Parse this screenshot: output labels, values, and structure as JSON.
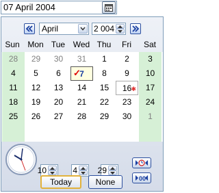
{
  "date_field": {
    "value": "07 April 2004"
  },
  "icons": {
    "calendar_dropdown": "calendar-icon",
    "prev_month": "double-chevron-left-icon",
    "next_month": "double-chevron-right-icon",
    "clock": "analog-clock-icon",
    "now": "set-now-icon",
    "clear_time": "clear-time-icon"
  },
  "calendar": {
    "month": "April",
    "year": "2 004",
    "weekdays": [
      "Sun",
      "Mon",
      "Tue",
      "Wed",
      "Thu",
      "Fri",
      "Sat"
    ],
    "weeks": [
      [
        "28",
        "29",
        "30",
        "31",
        "1",
        "2",
        "3"
      ],
      [
        "4",
        "5",
        "6",
        "7",
        "8",
        "9",
        "10"
      ],
      [
        "11",
        "12",
        "13",
        "14",
        "15",
        "16",
        "17"
      ],
      [
        "18",
        "19",
        "20",
        "21",
        "22",
        "23",
        "24"
      ],
      [
        "25",
        "26",
        "27",
        "28",
        "29",
        "30",
        "1"
      ]
    ]
  },
  "time": {
    "hour": "10",
    "minute": "4",
    "second": "29"
  },
  "buttons": {
    "today": "Today",
    "none": "None"
  },
  "colors": {
    "weekend_bg": "#d6f0d6",
    "panel_top": "#eef1f7",
    "panel_bottom": "#d5dce9",
    "accent_blue": "#2d4f9e",
    "today_bg": "#ffffe0",
    "checkmark": "#e00000"
  }
}
